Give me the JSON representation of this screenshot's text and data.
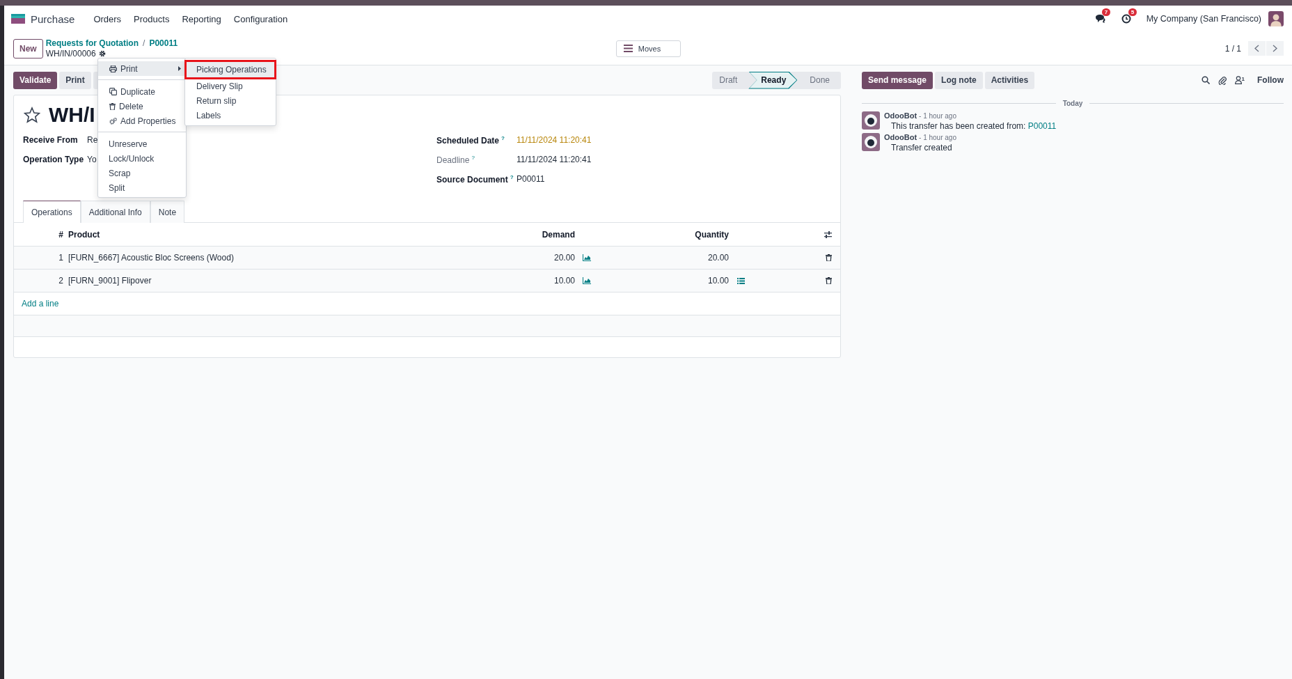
{
  "navbar": {
    "app": "Purchase",
    "menu": [
      "Orders",
      "Products",
      "Reporting",
      "Configuration"
    ],
    "messages_badge": "7",
    "activities_badge": "5",
    "company": "My Company (San Francisco)"
  },
  "control_panel": {
    "new_button": "New",
    "breadcrumb": [
      "Requests for Quotation",
      "P00011"
    ],
    "separator": "/",
    "record": "WH/IN/00006",
    "view_button": "Moves",
    "pager": "1 / 1"
  },
  "actions": [
    {
      "label": "Validate",
      "kind": "primary"
    },
    {
      "label": "Print",
      "kind": "secondary"
    },
    {
      "kind": "gear"
    }
  ],
  "statusbar": [
    {
      "label": "Draft",
      "selected": false
    },
    {
      "label": "Ready",
      "selected": true
    },
    {
      "label": "Done",
      "selected": false
    }
  ],
  "form": {
    "title": "WH/I",
    "starred": false,
    "fields_left": [
      {
        "label": "Receive From",
        "value": "Re"
      },
      {
        "label": "Operation Type",
        "value": "Yo"
      }
    ],
    "fields_right": [
      {
        "label": "Scheduled Date",
        "help": "?",
        "value": "11/11/2024 11:20:41",
        "required": true,
        "highlighted": true
      },
      {
        "label": "Deadline",
        "help": "?",
        "value": "11/11/2024 11:20:41",
        "required": false,
        "highlighted": false
      },
      {
        "label": "Source Document",
        "help": "?",
        "value": "P00011",
        "required": true,
        "highlighted": false
      }
    ],
    "tabs": [
      {
        "label": "Operations",
        "selected": true
      },
      {
        "label": "Additional Info",
        "selected": false
      },
      {
        "label": "Note",
        "selected": false
      }
    ],
    "table": {
      "columns": [
        "#",
        "Product",
        "Demand",
        "Quantity"
      ],
      "rows": [
        {
          "number": "1",
          "product": "[FURN_6667] Acoustic Bloc Screens (Wood)",
          "demand": "20.00",
          "quantity": "20.00",
          "details": false
        },
        {
          "number": "2",
          "product": "[FURN_9001] Flipover",
          "demand": "10.00",
          "quantity": "10.00",
          "details": true
        }
      ],
      "add_line": "Add a line"
    }
  },
  "dropdown": {
    "sections": [
      {
        "items": [
          {
            "label": "Print",
            "kind": "submenu",
            "selected": true
          }
        ]
      },
      {
        "items": [
          {
            "label": "Duplicate",
            "kind": "iconic",
            "selected": false
          },
          {
            "label": "Delete",
            "kind": "iconic",
            "selected": false
          },
          {
            "label": "Add Properties",
            "kind": "iconic",
            "selected": false
          }
        ]
      },
      {
        "items": [
          {
            "label": "Unreserve",
            "kind": "plain",
            "selected": false
          },
          {
            "label": "Lock/Unlock",
            "kind": "plain",
            "selected": false
          },
          {
            "label": "Scrap",
            "kind": "plain",
            "selected": false
          },
          {
            "label": "Split",
            "kind": "plain",
            "selected": false
          }
        ]
      }
    ],
    "submenu": [
      {
        "label": "Picking Operations",
        "selected": true
      },
      {
        "label": "Delivery Slip",
        "selected": false
      },
      {
        "label": "Return slip",
        "selected": false
      },
      {
        "label": "Labels",
        "selected": false
      }
    ]
  },
  "chatter": {
    "buttons": [
      {
        "label": "Send message",
        "kind": "primary"
      },
      {
        "label": "Log note",
        "kind": "secondary"
      },
      {
        "label": "Activities",
        "kind": "secondary"
      }
    ],
    "followers_count": "1",
    "follow": "Follow",
    "divider": "Today",
    "messages": [
      {
        "author": "OdooBot",
        "time": "- 1 hour ago",
        "body": "This transfer has been created from: ",
        "link": "P00011"
      },
      {
        "author": "OdooBot",
        "time": "- 1 hour ago",
        "body": "Transfer created"
      }
    ]
  }
}
